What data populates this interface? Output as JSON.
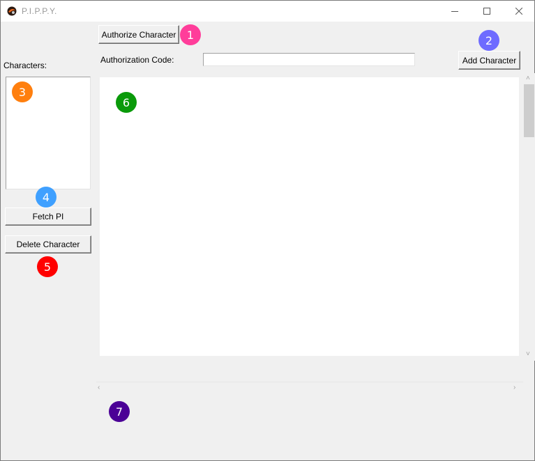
{
  "window": {
    "title": "P.I.P.P.Y."
  },
  "toolbar": {
    "authorize_label": "Authorize Character",
    "add_label": "Add Character",
    "auth_code_label": "Authorization Code:",
    "auth_code_value": ""
  },
  "sidebar": {
    "characters_label": "Characters:",
    "items": [],
    "fetch_label": "Fetch PI",
    "delete_label": "Delete Character"
  },
  "markers": [
    {
      "number": "1",
      "color": "#ff3d9a"
    },
    {
      "number": "2",
      "color": "#6e6bff"
    },
    {
      "number": "3",
      "color": "#ff7f0e"
    },
    {
      "number": "4",
      "color": "#3fa0ff"
    },
    {
      "number": "5",
      "color": "#ff0000"
    },
    {
      "number": "6",
      "color": "#0a9a0a"
    },
    {
      "number": "7",
      "color": "#4b0096"
    }
  ]
}
